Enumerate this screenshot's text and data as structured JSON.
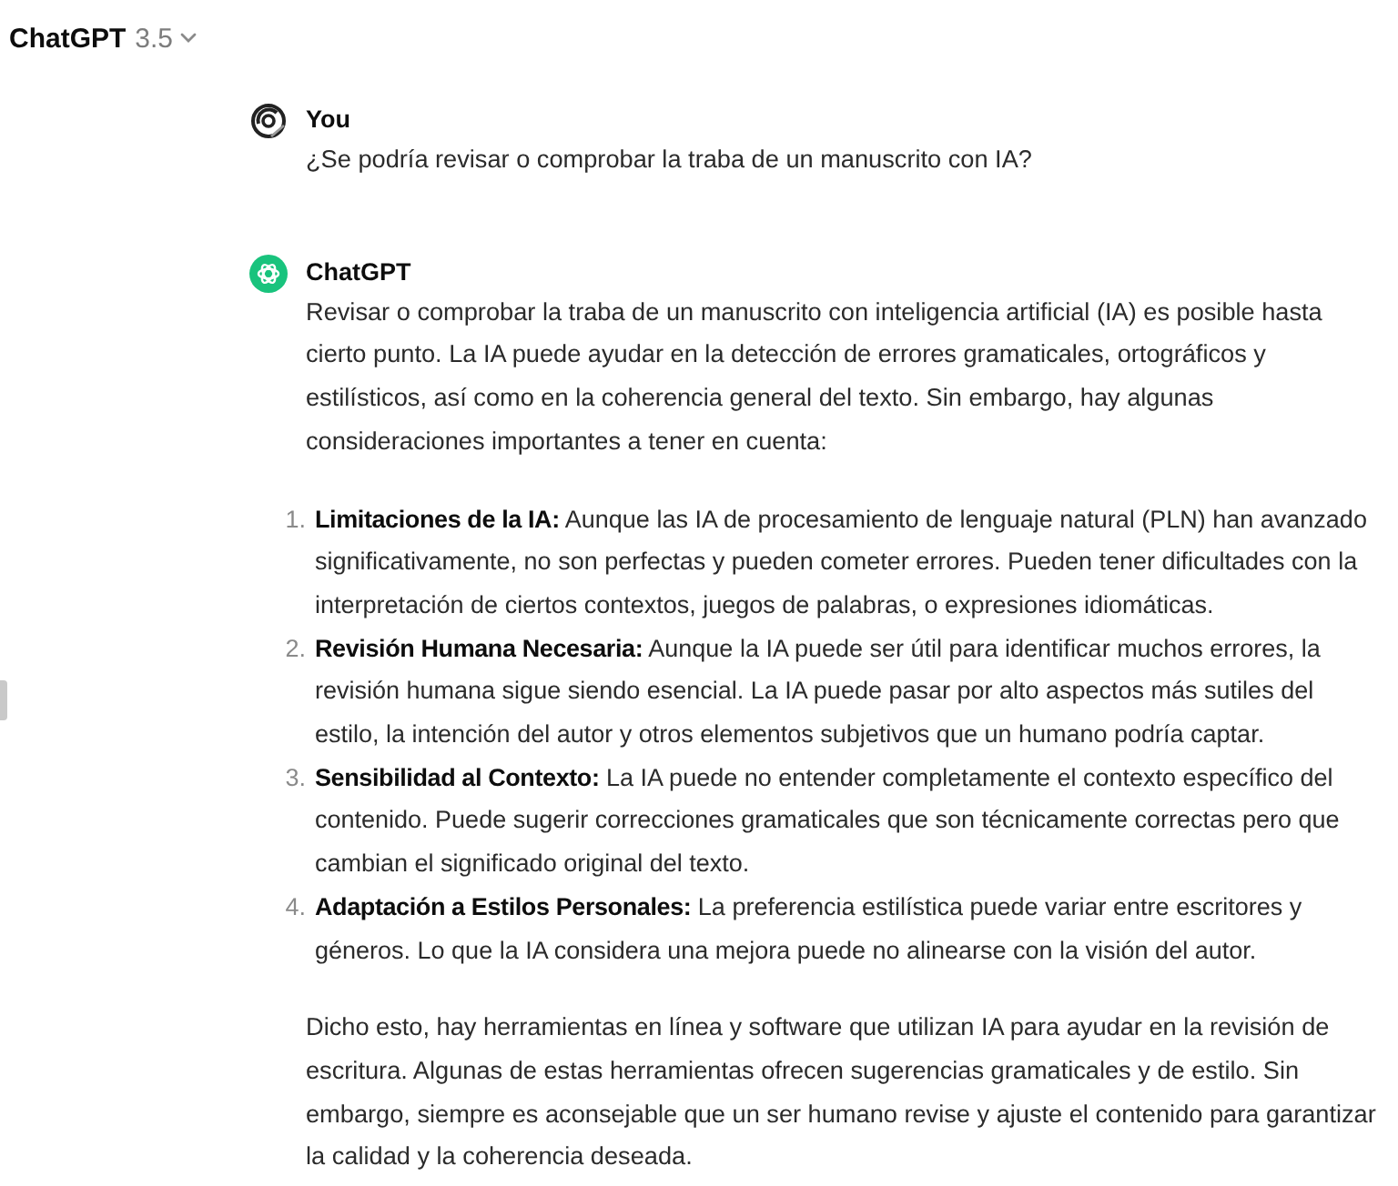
{
  "header": {
    "title": "ChatGPT",
    "version": "3.5"
  },
  "messages": [
    {
      "kind": "user",
      "author": "You",
      "blocks": [
        {
          "kind": "paragraph",
          "text": "¿Se podría revisar o comprobar la traba de un manuscrito con IA?"
        }
      ]
    },
    {
      "kind": "assistant",
      "author": "ChatGPT",
      "blocks": [
        {
          "kind": "paragraph",
          "text": "Revisar o comprobar la traba de un manuscrito con inteligencia artificial (IA) es posible hasta cierto punto. La IA puede ayudar en la detección de errores gramaticales, ortográficos y estilísticos, así como en la coherencia general del texto. Sin embargo, hay algunas consideraciones importantes a tener en cuenta:"
        },
        {
          "kind": "list",
          "items": [
            {
              "number": "1.",
              "text": "**Limitaciones de la IA:** Aunque las IA de procesamiento de lenguaje natural (PLN) han avanzado significativamente, no son perfectas y pueden cometer errores. Pueden tener dificultades con la interpretación de ciertos contextos, juegos de palabras, o expresiones idiomáticas."
            },
            {
              "number": "2.",
              "text": "**Revisión Humana Necesaria:** Aunque la IA puede ser útil para identificar muchos errores, la revisión humana sigue siendo esencial. La IA puede pasar por alto aspectos más sutiles del estilo, la intención del autor y otros elementos subjetivos que un humano podría captar."
            },
            {
              "number": "3.",
              "text": "**Sensibilidad al Contexto:** La IA puede no entender completamente el contexto específico del contenido. Puede sugerir correcciones gramaticales que son técnicamente correctas pero que cambian el significado original del texto."
            },
            {
              "number": "4.",
              "text": "**Adaptación a Estilos Personales:** La preferencia estilística puede variar entre escritores y géneros. Lo que la IA considera una mejora puede no alinearse con la visión del autor."
            }
          ]
        },
        {
          "kind": "paragraph",
          "text": "Dicho esto, hay herramientas en línea y software que utilizan IA para ayudar en la revisión de escritura. Algunas de estas herramientas ofrecen sugerencias gramaticales y de estilo. Sin embargo, siempre es aconsejable que un ser humano revise y ajuste el contenido para garantizar la calidad y la coherencia deseada."
        }
      ]
    }
  ]
}
